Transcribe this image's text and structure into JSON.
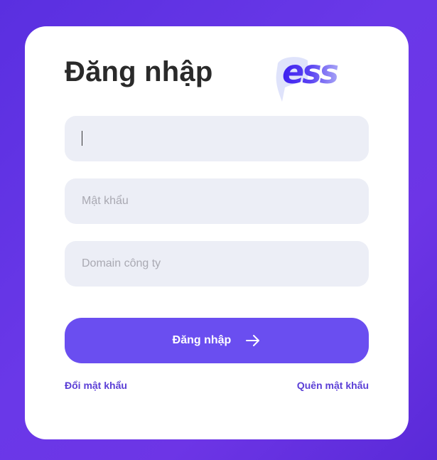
{
  "login": {
    "title": "Đăng nhập",
    "logo_text": "ess",
    "username": {
      "value": "",
      "placeholder": ""
    },
    "password": {
      "value": "",
      "placeholder": "Mật khẩu"
    },
    "domain": {
      "value": "",
      "placeholder": "Domain công ty"
    },
    "submit_label": "Đăng nhập",
    "submit_icon": "arrow-right-icon",
    "change_password_link": "Đổi mật khẩu",
    "forgot_password_link": "Quên mật khẩu"
  },
  "colors": {
    "background": "#6236e4",
    "card": "#ffffff",
    "field_bg": "#eceef6",
    "button": "#6a4ef0",
    "link": "#5b3fd6",
    "logo": "#4a2bf0"
  }
}
